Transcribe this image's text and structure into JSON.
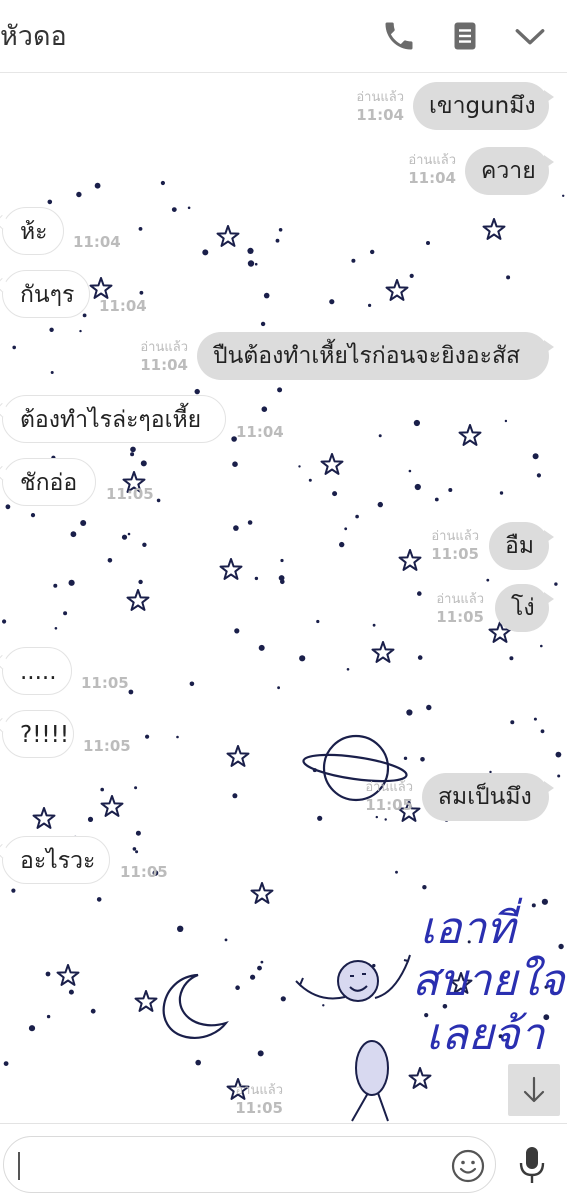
{
  "header": {
    "title": "หัวดอ",
    "icons": [
      "phone-icon",
      "notes-icon",
      "chevron-down-icon"
    ]
  },
  "messages": [
    {
      "side": "out",
      "text": "เขาgunมึง",
      "read": "อ่านแล้ว",
      "time": "11:04"
    },
    {
      "side": "out",
      "text": "ควาย",
      "read": "อ่านแล้ว",
      "time": "11:04"
    },
    {
      "side": "in",
      "text": "ห้ะ",
      "time": "11:04"
    },
    {
      "side": "in",
      "text": "กันๆร",
      "time": "11:04"
    },
    {
      "side": "out",
      "text": "ปืนต้องทำเหี้ยไรก่อนจะยิงอะสัส",
      "read": "อ่านแล้ว",
      "time": "11:04"
    },
    {
      "side": "in",
      "text": "ต้องทำไรล่ะๆอเหี้ย",
      "time": "11:04"
    },
    {
      "side": "in",
      "text": "ชักอ่อ",
      "time": "11:05"
    },
    {
      "side": "out",
      "text": "อืม",
      "read": "อ่านแล้ว",
      "time": "11:05"
    },
    {
      "side": "out",
      "text": "โง่",
      "read": "อ่านแล้ว",
      "time": "11:05"
    },
    {
      "side": "in",
      "text": ".....",
      "time": "11:05"
    },
    {
      "side": "in",
      "text": "?!!!!",
      "time": "11:05"
    },
    {
      "side": "out",
      "text": "สมเป็นมึง",
      "read": "อ่านแล้ว",
      "time": "11:05"
    },
    {
      "side": "in",
      "text": "อะไรวะ",
      "time": "11:05"
    }
  ],
  "last_sent_meta": {
    "read": "อ่านแล้ว",
    "time": "11:05"
  },
  "background": {
    "handwriting": [
      "เอาที่",
      "สบายใจ",
      "เลยจ้า"
    ],
    "ink_color": "#1a1f4a",
    "figure_color": "#d8d9f0"
  },
  "input": {
    "value": "",
    "placeholder": ""
  },
  "footer_icons": [
    "emoji-icon",
    "microphone-icon"
  ],
  "scroll_button_icon": "arrow-down-icon",
  "colors": {
    "outgoing_bubble": "#dcdcdc",
    "incoming_bubble": "#ffffff",
    "meta_text": "#bcbcbc"
  }
}
